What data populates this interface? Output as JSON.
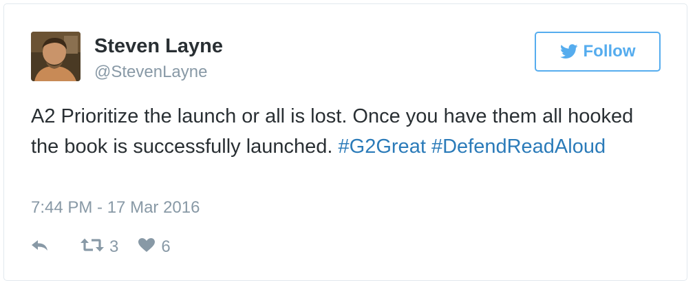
{
  "author": {
    "name": "Steven Layne",
    "handle": "@StevenLayne"
  },
  "follow_button": {
    "label": "Follow"
  },
  "tweet": {
    "text_before": "A2 Prioritize the launch or all is lost. Once you have them all hooked the book is successfully launched. ",
    "hashtags": [
      "#G2Great",
      "#DefendReadAloud"
    ],
    "timestamp": "7:44 PM - 17 Mar 2016"
  },
  "actions": {
    "retweet_count": "3",
    "like_count": "6"
  },
  "icons": {
    "reply": "reply-icon",
    "retweet": "retweet-icon",
    "like": "heart-icon",
    "follow": "twitter-bird-icon"
  },
  "colors": {
    "accent": "#55acee",
    "link": "#2b7bb9",
    "muted": "#8899a6",
    "text": "#292f33"
  }
}
